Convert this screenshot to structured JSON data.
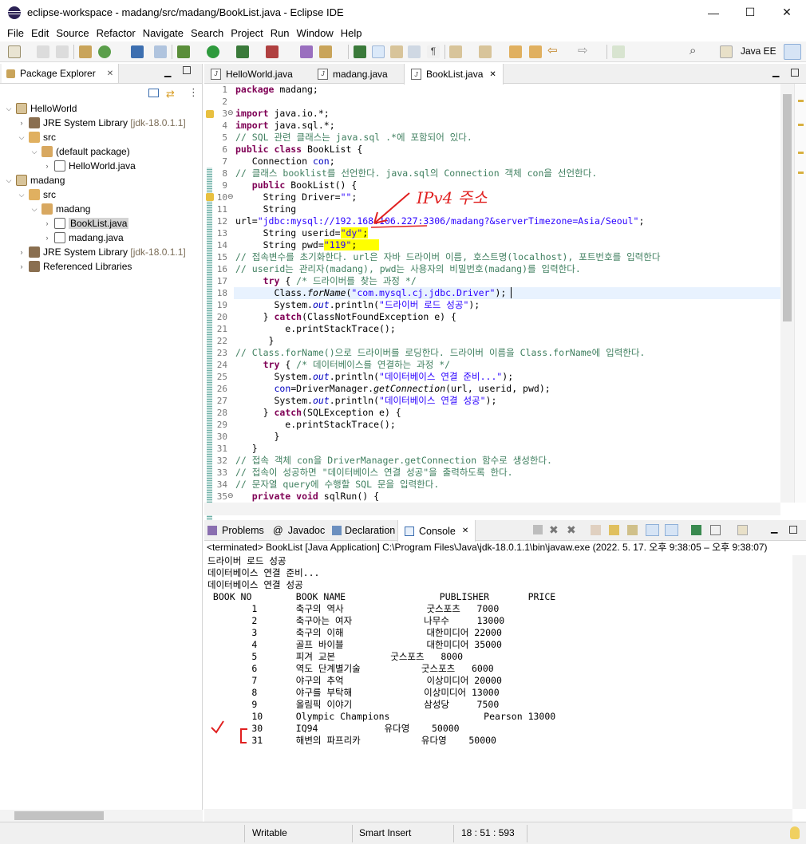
{
  "window": {
    "title": "eclipse-workspace - madang/src/madang/BookList.java - Eclipse IDE",
    "minimize": "—",
    "maximize": "☐",
    "close": "✕"
  },
  "menu": [
    "File",
    "Edit",
    "Source",
    "Refactor",
    "Navigate",
    "Search",
    "Project",
    "Run",
    "Window",
    "Help"
  ],
  "toolbar": {
    "perspective": "Java EE"
  },
  "package_explorer": {
    "title": "Package Explorer",
    "tree": [
      {
        "label": "HelloWorld",
        "extra": ""
      },
      {
        "label": "JRE System Library",
        "extra": "[jdk-18.0.1.1]"
      },
      {
        "label": "src",
        "extra": ""
      },
      {
        "label": "(default package)",
        "extra": ""
      },
      {
        "label": "HelloWorld.java",
        "extra": ""
      },
      {
        "label": "madang",
        "extra": ""
      },
      {
        "label": "src",
        "extra": ""
      },
      {
        "label": "madang",
        "extra": ""
      },
      {
        "label": "BookList.java",
        "extra": ""
      },
      {
        "label": "madang.java",
        "extra": ""
      },
      {
        "label": "JRE System Library",
        "extra": "[jdk-18.0.1.1]"
      },
      {
        "label": "Referenced Libraries",
        "extra": ""
      }
    ]
  },
  "editor": {
    "tabs": [
      "HelloWorld.java",
      "madang.java",
      "BookList.java"
    ],
    "line_numbers": [
      "1",
      "2",
      "3",
      "4",
      "5",
      "6",
      "7",
      "8",
      "9",
      "10",
      "11",
      "12",
      "13",
      "14",
      "15",
      "16",
      "17",
      "18",
      "19",
      "20",
      "21",
      "22",
      "23",
      "24",
      "25",
      "26",
      "27",
      "28",
      "29",
      "30",
      "31",
      "32",
      "33",
      "34",
      "35"
    ],
    "annotation": "IPv4 주소",
    "code": {
      "l1a": "package",
      "l1b": " madang;",
      "l3a": "import",
      "l3b": " java.io.*;",
      "l4a": "import",
      "l4b": " java.sql.*;",
      "l5": "// SQL 관련 클래스는 java.sql .*에 포함되어 있다.",
      "l6a": "public class",
      "l6b": " BookList {",
      "l7a": "   Connection ",
      "l7b": "con",
      ";": ";",
      "l8": "// 클래스 booklist를 선언한다. java.sql의 Connection 객체 con을 선언한다.",
      "l9a": "   public",
      "l9b": " BookList() {",
      "l10a": "     String Driver=",
      "l10b": "\"\"",
      "l10c": ";",
      "l11": "     String",
      "l12a": "url=",
      "l12b": "\"jdbc:mysql://192.168.106.227:3306/madang?&serverTimezone=Asia/Seoul\"",
      "l12c": ";",
      "l13a": "     String userid=",
      "l13b": "\"dy\"",
      "l13c": ";",
      "l14a": "     String pwd=",
      "l14b": "\"119\"",
      "l14c": ";",
      "l15": "// 접속변수를 초기화한다. url은 자바 드라이버 이름, 호스트명(localhost), 포트번호를 입력한다",
      "l16": "// userid는 관리자(madang), pwd는 사용자의 비밀번호(madang)를 입력한다.",
      "l17a": "     try",
      "l17b": " { ",
      "l17c": "/* 드라이버를 찾는 과정 */",
      "l18a": "       Class.",
      "l18b": "forName",
      "l18c": "(",
      "l18d": "\"com.mysql.cj.jdbc.Driver\"",
      "l18e": ");",
      "l19a": "       System.",
      "l19b": "out",
      "l19c": ".println(",
      "l19d": "\"드라이버 로드 성공\"",
      "l19e": ");",
      "l20a": "     } ",
      "l20b": "catch",
      "l20c": "(ClassNotFoundException e) {",
      "l21": "         e.printStackTrace();",
      "l22": "      }",
      "l23": "// Class.forName()으로 드라이버를 로딩한다. 드라이버 이름을 Class.forName에 입력한다.",
      "l24a": "     try",
      "l24b": " { ",
      "l24c": "/* 데이터베이스를 연결하는 과정 */",
      "l25a": "       System.",
      "l25b": "out",
      "l25c": ".println(",
      "l25d": "\"데이터베이스 연결 준비...\"",
      "l25e": ");",
      "l26a": "       ",
      "l26b": "con",
      "l26c": "=DriverManager.",
      "l26d": "getConnection",
      "l26e": "(url, userid, pwd);",
      "l27a": "       System.",
      "l27b": "out",
      "l27c": ".println(",
      "l27d": "\"데이터베이스 연결 성공\"",
      "l27e": ");",
      "l28a": "     } ",
      "l28b": "catch",
      "l28c": "(SQLException e) {",
      "l29": "         e.printStackTrace();",
      "l30": "       }",
      "l31": "   }",
      "l32": "// 접속 객체 con을 DriverManager.getConnection 함수로 생성한다.",
      "l33": "// 접속이 성공하면 \"데이터베이스 연결 성공\"을 출력하도록 한다.",
      "l34": "// 문자열 query에 수행할 SQL 문을 입력한다.",
      "l35a": "   private void",
      "l35b": " sqlRun() {"
    }
  },
  "console": {
    "tabs": [
      "Problems",
      "Javadoc",
      "Declaration",
      "Console"
    ],
    "header": "<terminated> BookList [Java Application] C:\\Program Files\\Java\\jdk-18.0.1.1\\bin\\javaw.exe  (2022. 5. 17. 오후 9:38:05 – 오후 9:38:07)",
    "lines": [
      "드라이버 로드 성공",
      "데이터베이스 연결 준비...",
      "데이터베이스 연결 성공",
      " BOOK NO        BOOK NAME                 PUBLISHER       PRICE",
      "        1       축구의 역사               굿스포츠   7000",
      "        2       축구아는 여자             나무수     13000",
      "        3       축구의 이해               대한미디어 22000",
      "        4       골프 바이블               대한미디어 35000",
      "        5       피겨 교본          굿스포츠   8000",
      "        6       역도 단계별기술           굿스포츠   6000",
      "        7       야구의 추억               이상미디어 20000",
      "        8       야구를 부탁해             이상미디어 13000",
      "        9       올림픽 이야기             삼성당     7500",
      "        10      Olympic Champions                 Pearson 13000",
      "        30      IQ94            유다영    50000",
      "        31      해변의 파프리카           유다영    50000"
    ]
  },
  "statusbar": {
    "mode": "Writable",
    "insert": "Smart Insert",
    "position": "18 : 51 : 593"
  }
}
